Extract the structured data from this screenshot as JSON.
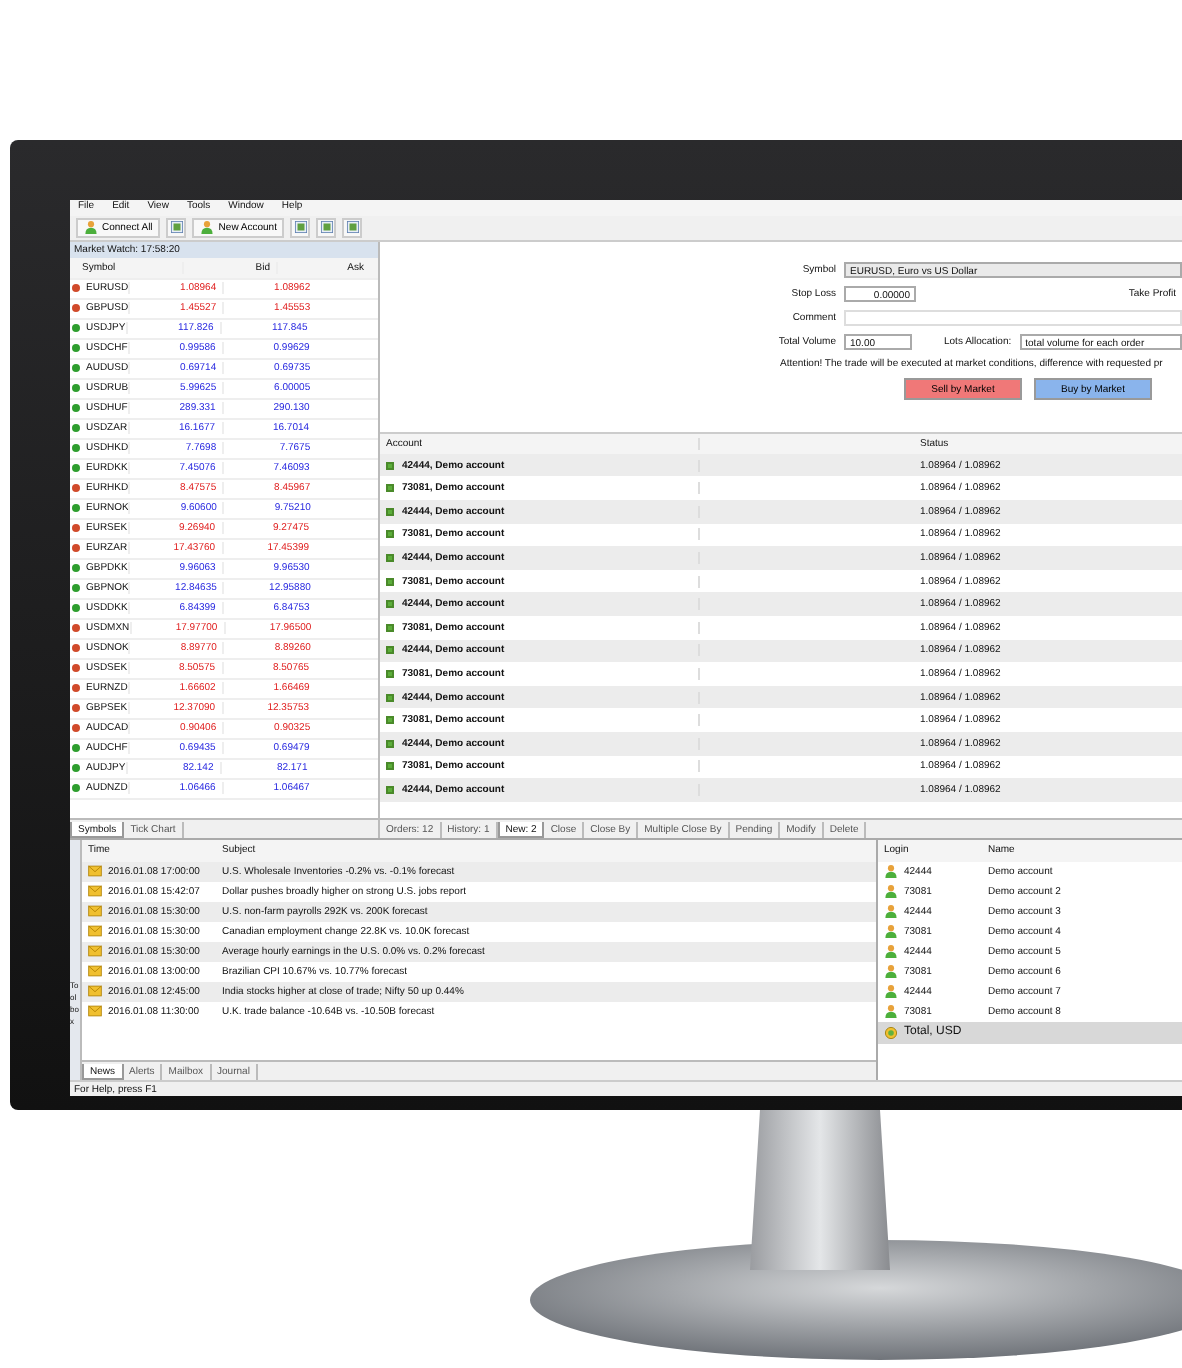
{
  "menu": [
    "File",
    "Edit",
    "View",
    "Tools",
    "Window",
    "Help"
  ],
  "toolbar": [
    {
      "kind": "connect",
      "label": "Connect All"
    },
    {
      "kind": "icon"
    },
    {
      "kind": "account",
      "label": "New Account"
    },
    {
      "kind": "icon"
    },
    {
      "kind": "icon"
    },
    {
      "kind": "icon"
    }
  ],
  "market_watch": {
    "title": "Market Watch: 17:58:20",
    "columns": [
      "Symbol",
      "Bid",
      "Ask"
    ],
    "rows": [
      {
        "symbol": "EURUSD",
        "bid": "1.08964",
        "ask": "1.08962",
        "color": "#d04a2a"
      },
      {
        "symbol": "GBPUSD",
        "bid": "1.45527",
        "ask": "1.45553",
        "color": "#d04a2a"
      },
      {
        "symbol": "USDJPY",
        "bid": "117.826",
        "ask": "117.845",
        "color": "#2e9e2e"
      },
      {
        "symbol": "USDCHF",
        "bid": "0.99586",
        "ask": "0.99629",
        "color": "#2e9e2e"
      },
      {
        "symbol": "AUDUSD",
        "bid": "0.69714",
        "ask": "0.69735",
        "color": "#2e9e2e"
      },
      {
        "symbol": "USDRUB",
        "bid": "5.99625",
        "ask": "6.00005",
        "color": "#2e9e2e"
      },
      {
        "symbol": "USDHUF",
        "bid": "289.331",
        "ask": "290.130",
        "color": "#2e9e2e"
      },
      {
        "symbol": "USDZAR",
        "bid": "16.1677",
        "ask": "16.7014",
        "color": "#2e9e2e"
      },
      {
        "symbol": "USDHKD",
        "bid": "7.7698",
        "ask": "7.7675",
        "color": "#2e9e2e"
      },
      {
        "symbol": "EURDKK",
        "bid": "7.45076",
        "ask": "7.46093",
        "color": "#2e9e2e"
      },
      {
        "symbol": "EURHKD",
        "bid": "8.47575",
        "ask": "8.45967",
        "color": "#d04a2a"
      },
      {
        "symbol": "EURNOK",
        "bid": "9.60600",
        "ask": "9.75210",
        "color": "#2e9e2e"
      },
      {
        "symbol": "EURSEK",
        "bid": "9.26940",
        "ask": "9.27475",
        "color": "#d04a2a"
      },
      {
        "symbol": "EURZAR",
        "bid": "17.43760",
        "ask": "17.45399",
        "color": "#d04a2a"
      },
      {
        "symbol": "GBPDKK",
        "bid": "9.96063",
        "ask": "9.96530",
        "color": "#2e9e2e"
      },
      {
        "symbol": "GBPNOK",
        "bid": "12.84635",
        "ask": "12.95880",
        "color": "#2e9e2e"
      },
      {
        "symbol": "USDDKK",
        "bid": "6.84399",
        "ask": "6.84753",
        "color": "#2e9e2e"
      },
      {
        "symbol": "USDMXN",
        "bid": "17.97700",
        "ask": "17.96500",
        "color": "#d04a2a"
      },
      {
        "symbol": "USDNOK",
        "bid": "8.89770",
        "ask": "8.89260",
        "color": "#d04a2a"
      },
      {
        "symbol": "USDSEK",
        "bid": "8.50575",
        "ask": "8.50765",
        "color": "#d04a2a"
      },
      {
        "symbol": "EURNZD",
        "bid": "1.66602",
        "ask": "1.66469",
        "color": "#d04a2a"
      },
      {
        "symbol": "GBPSEK",
        "bid": "12.37090",
        "ask": "12.35753",
        "color": "#d04a2a"
      },
      {
        "symbol": "AUDCAD",
        "bid": "0.90406",
        "ask": "0.90325",
        "color": "#d04a2a"
      },
      {
        "symbol": "AUDCHF",
        "bid": "0.69435",
        "ask": "0.69479",
        "color": "#2e9e2e"
      },
      {
        "symbol": "AUDJPY",
        "bid": "82.142",
        "ask": "82.171",
        "color": "#2e9e2e"
      },
      {
        "symbol": "AUDNZD",
        "bid": "1.06466",
        "ask": "1.06467",
        "color": "#2e9e2e"
      }
    ],
    "tabs": [
      {
        "label": "Symbols",
        "selected": true
      },
      {
        "label": "Tick Chart",
        "selected": false
      }
    ]
  },
  "order_form": {
    "symbol_label": "Symbol",
    "symbol": "EURUSD, Euro vs US Dollar",
    "stop_loss_label": "Stop Loss",
    "stop_loss": "0.00000",
    "take_profit_label": "Take Profit",
    "comment_label": "Comment",
    "volume_label": "Total Volume",
    "volume": "10.00",
    "allocation_label": "Lots Allocation:",
    "allocation": "total volume for each order",
    "attention": "Attention! The trade will be executed at market conditions, difference with requested pr",
    "sell": "Sell by Market",
    "buy": "Buy by Market"
  },
  "orders_table": {
    "columns": [
      "Account",
      "Status"
    ],
    "rows": [
      {
        "checked": true,
        "account": "42444, Demo account",
        "status": "1.08964 / 1.08962"
      },
      {
        "checked": true,
        "account": "73081, Demo account",
        "status": "1.08964 / 1.08962"
      },
      {
        "checked": true,
        "account": "42444, Demo account",
        "status": "1.08964 / 1.08962"
      },
      {
        "checked": true,
        "account": "73081, Demo account",
        "status": "1.08964 / 1.08962"
      },
      {
        "checked": true,
        "account": "42444, Demo account",
        "status": "1.08964 / 1.08962"
      },
      {
        "checked": true,
        "account": "73081, Demo account",
        "status": "1.08964 / 1.08962"
      },
      {
        "checked": true,
        "account": "42444, Demo account",
        "status": "1.08964 / 1.08962"
      },
      {
        "checked": true,
        "account": "73081, Demo account",
        "status": "1.08964 / 1.08962"
      },
      {
        "checked": true,
        "account": "42444, Demo account",
        "status": "1.08964 / 1.08962"
      },
      {
        "checked": true,
        "account": "73081, Demo account",
        "status": "1.08964 / 1.08962"
      },
      {
        "checked": true,
        "account": "42444, Demo account",
        "status": "1.08964 / 1.08962"
      },
      {
        "checked": true,
        "account": "73081, Demo account",
        "status": "1.08964 / 1.08962"
      },
      {
        "checked": true,
        "account": "42444, Demo account",
        "status": "1.08964 / 1.08962"
      },
      {
        "checked": true,
        "account": "73081, Demo account",
        "status": "1.08964 / 1.08962"
      },
      {
        "checked": true,
        "account": "42444, Demo account",
        "status": "1.08964 / 1.08962"
      }
    ],
    "tabs": [
      {
        "label": "Orders: 12",
        "selected": false
      },
      {
        "label": "History: 1",
        "selected": false
      },
      {
        "label": "New: 2",
        "selected": true
      },
      {
        "label": "Close",
        "selected": false
      },
      {
        "label": "Close By",
        "selected": false
      },
      {
        "label": "Multiple Close By",
        "selected": false
      },
      {
        "label": "Pending",
        "selected": false
      },
      {
        "label": "Modify",
        "selected": false
      },
      {
        "label": "Delete",
        "selected": false
      }
    ]
  },
  "toolbox": {
    "label": "Toolbox",
    "columns": [
      "Time",
      "Subject"
    ],
    "rows": [
      {
        "time": "2016.01.08 17:00:00",
        "subject": "U.S. Wholesale Inventories -0.2% vs. -0.1% forecast"
      },
      {
        "time": "2016.01.08 15:42:07",
        "subject": "Dollar pushes broadly higher on strong U.S. jobs report"
      },
      {
        "time": "2016.01.08 15:30:00",
        "subject": "U.S. non-farm payrolls 292K vs. 200K forecast"
      },
      {
        "time": "2016.01.08 15:30:00",
        "subject": "Canadian employment change 22.8K vs. 10.0K forecast"
      },
      {
        "time": "2016.01.08 15:30:00",
        "subject": "Average hourly earnings in the U.S. 0.0% vs. 0.2% forecast"
      },
      {
        "time": "2016.01.08 13:00:00",
        "subject": "Brazilian CPI 10.67% vs. 10.77% forecast"
      },
      {
        "time": "2016.01.08 12:45:00",
        "subject": "India stocks higher at close of trade; Nifty 50 up 0.44%"
      },
      {
        "time": "2016.01.08 11:30:00",
        "subject": "U.K. trade balance -10.64B vs. -10.50B forecast"
      }
    ],
    "tabs": [
      {
        "label": "News",
        "selected": true
      },
      {
        "label": "Alerts",
        "selected": false
      },
      {
        "label": "Mailbox",
        "selected": false
      },
      {
        "label": "Journal",
        "selected": false
      }
    ]
  },
  "accounts": {
    "columns": [
      "Login",
      "Name"
    ],
    "rows": [
      {
        "login": "42444",
        "name": "Demo account"
      },
      {
        "login": "73081",
        "name": "Demo account 2"
      },
      {
        "login": "42444",
        "name": "Demo account 3"
      },
      {
        "login": "73081",
        "name": "Demo account 4"
      },
      {
        "login": "42444",
        "name": "Demo account 5"
      },
      {
        "login": "73081",
        "name": "Demo account 6"
      },
      {
        "login": "42444",
        "name": "Demo account 7"
      },
      {
        "login": "73081",
        "name": "Demo account 8"
      }
    ],
    "total": "Total, USD"
  },
  "status_bar": "For Help, press F1"
}
